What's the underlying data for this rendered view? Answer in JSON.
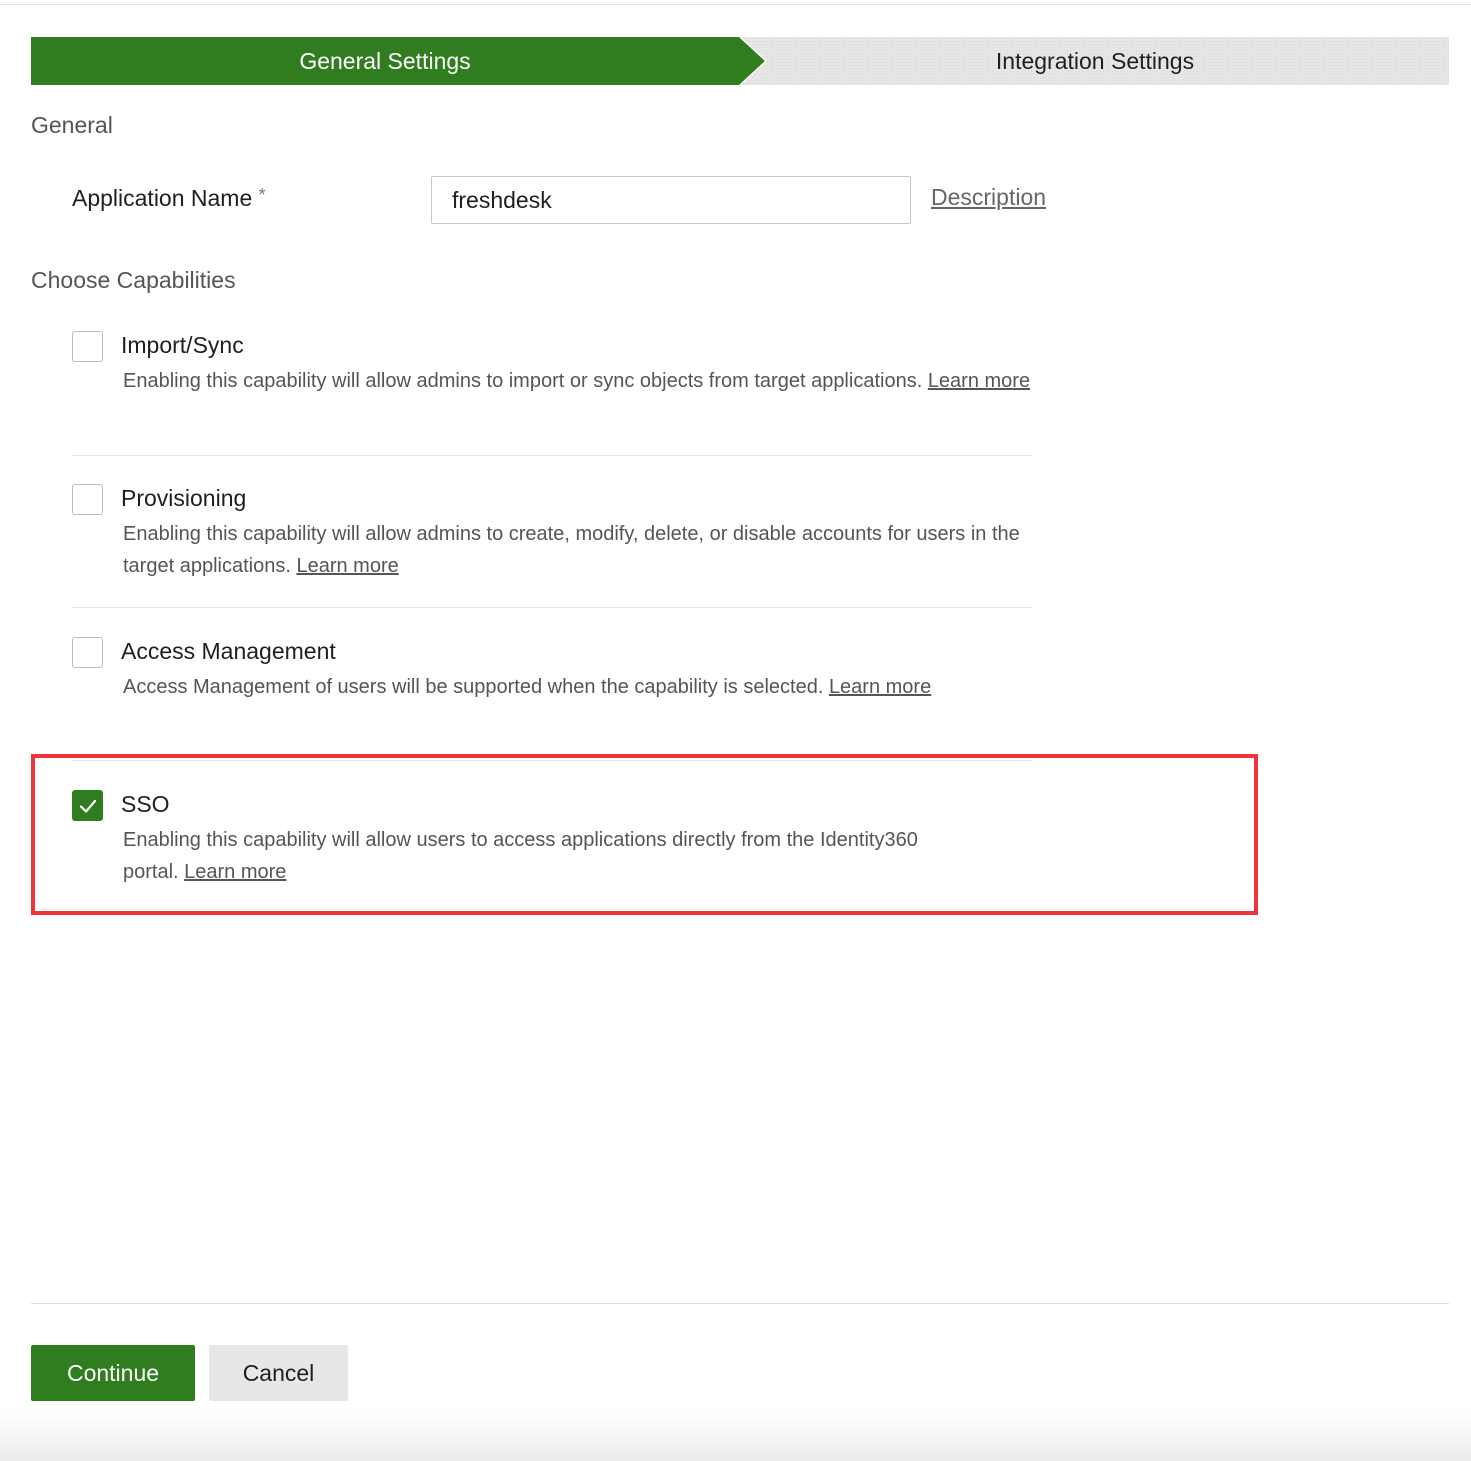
{
  "stepper": {
    "steps": [
      {
        "label": "General Settings",
        "state": "active"
      },
      {
        "label": "Integration Settings",
        "state": "inactive"
      }
    ]
  },
  "general": {
    "title": "General",
    "app_name_label": "Application Name",
    "required_mark": "*",
    "app_name_value": "freshdesk",
    "description_link": "Description"
  },
  "capabilities": {
    "title": "Choose Capabilities",
    "items": [
      {
        "label": "Import/Sync",
        "checked": false,
        "description": "Enabling this capability will allow admins to import or sync objects from target applications.",
        "learn_more": "Learn more"
      },
      {
        "label": "Provisioning",
        "checked": false,
        "description": "Enabling this capability will allow admins to create, modify, delete, or disable accounts for users in the target applications.",
        "learn_more": "Learn more"
      },
      {
        "label": "Access Management",
        "checked": false,
        "description": "Access Management of users will be supported when the capability is selected.",
        "learn_more": "Learn more"
      },
      {
        "label": "SSO",
        "checked": true,
        "description": "Enabling this capability will allow users to access applications directly from the Identity360 portal.",
        "learn_more": "Learn more"
      }
    ]
  },
  "actions": {
    "continue_label": "Continue",
    "cancel_label": "Cancel"
  },
  "colors": {
    "accent": "#2f7d1f",
    "highlight": "#f0343f"
  },
  "icons": {
    "checkmark": "check-icon"
  }
}
